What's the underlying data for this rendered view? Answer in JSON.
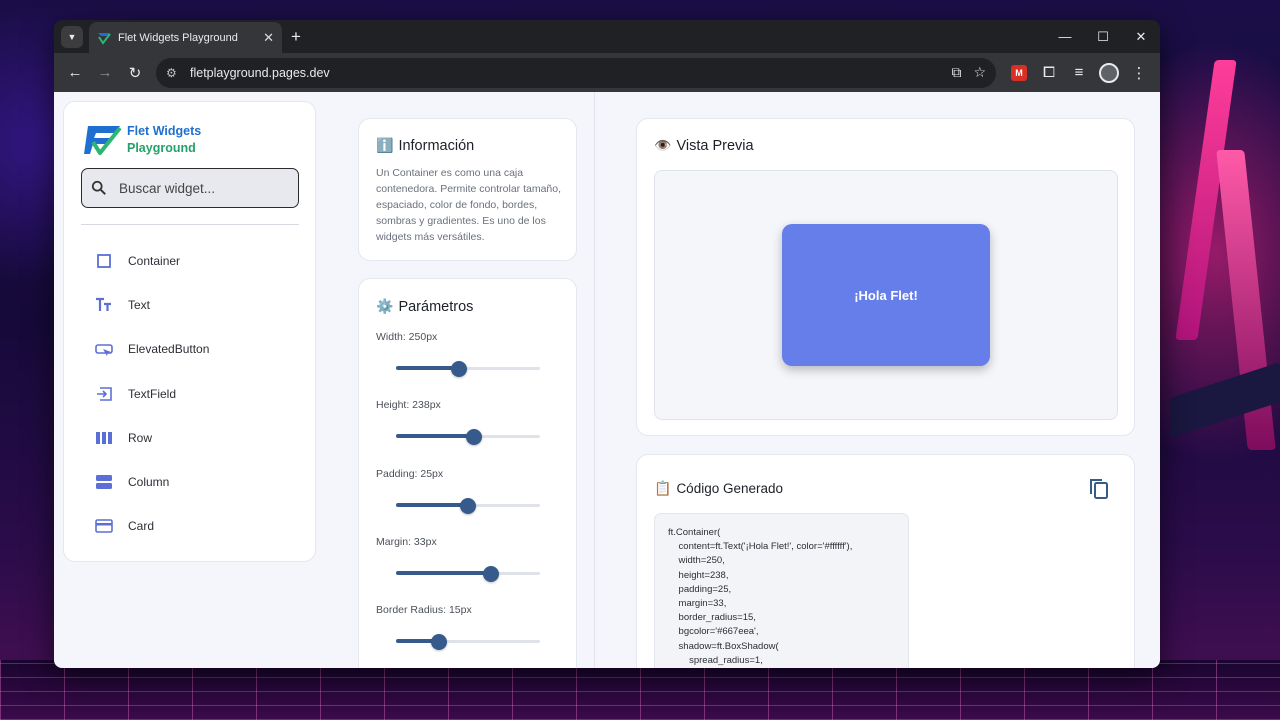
{
  "browser": {
    "tab_title": "Flet Widgets Playground",
    "url": "fletplayground.pages.dev",
    "ext_label": "M"
  },
  "app": {
    "logo_line1": "Flet Widgets",
    "logo_line2": "Playground"
  },
  "sidebar": {
    "search_placeholder": "Buscar widget...",
    "items": [
      {
        "label": "Container",
        "icon": "square-outline-icon"
      },
      {
        "label": "Text",
        "icon": "text-fields-icon"
      },
      {
        "label": "ElevatedButton",
        "icon": "smart-button-icon"
      },
      {
        "label": "TextField",
        "icon": "input-icon"
      },
      {
        "label": "Row",
        "icon": "view-column-icon"
      },
      {
        "label": "Column",
        "icon": "view-stream-icon"
      },
      {
        "label": "Card",
        "icon": "credit-card-icon"
      }
    ]
  },
  "info": {
    "emoji": "ℹ️",
    "title": "Información",
    "text": "Un Container es como una caja contenedora. Permite controlar tamaño, espaciado, color de fondo, bordes, sombras y gradientes. Es uno de los widgets más versátiles."
  },
  "params": {
    "emoji": "⚙️",
    "title": "Parámetros",
    "items": [
      {
        "label": "Width: 250px",
        "fraction": 0.44
      },
      {
        "label": "Height: 238px",
        "fraction": 0.54
      },
      {
        "label": "Padding: 25px",
        "fraction": 0.5
      },
      {
        "label": "Margin: 33px",
        "fraction": 0.66
      },
      {
        "label": "Border Radius: 15px",
        "fraction": 0.3
      }
    ]
  },
  "preview": {
    "emoji": "👁️",
    "title": "Vista Previa",
    "box_text": "¡Hola Flet!",
    "box_color": "#667eea"
  },
  "code": {
    "emoji": "📋",
    "title": "Código Generado",
    "lines": [
      "ft.Container(",
      "    content=ft.Text('¡Hola Flet!', color='#ffffff'),",
      "    width=250,",
      "    height=238,",
      "    padding=25,",
      "    margin=33,",
      "    border_radius=15,",
      "    bgcolor='#667eea',",
      "    shadow=ft.BoxShadow(",
      "        spread_radius=1,"
    ]
  },
  "colors": {
    "accent": "#375a8c",
    "nav_icon": "#5b6fd6"
  }
}
